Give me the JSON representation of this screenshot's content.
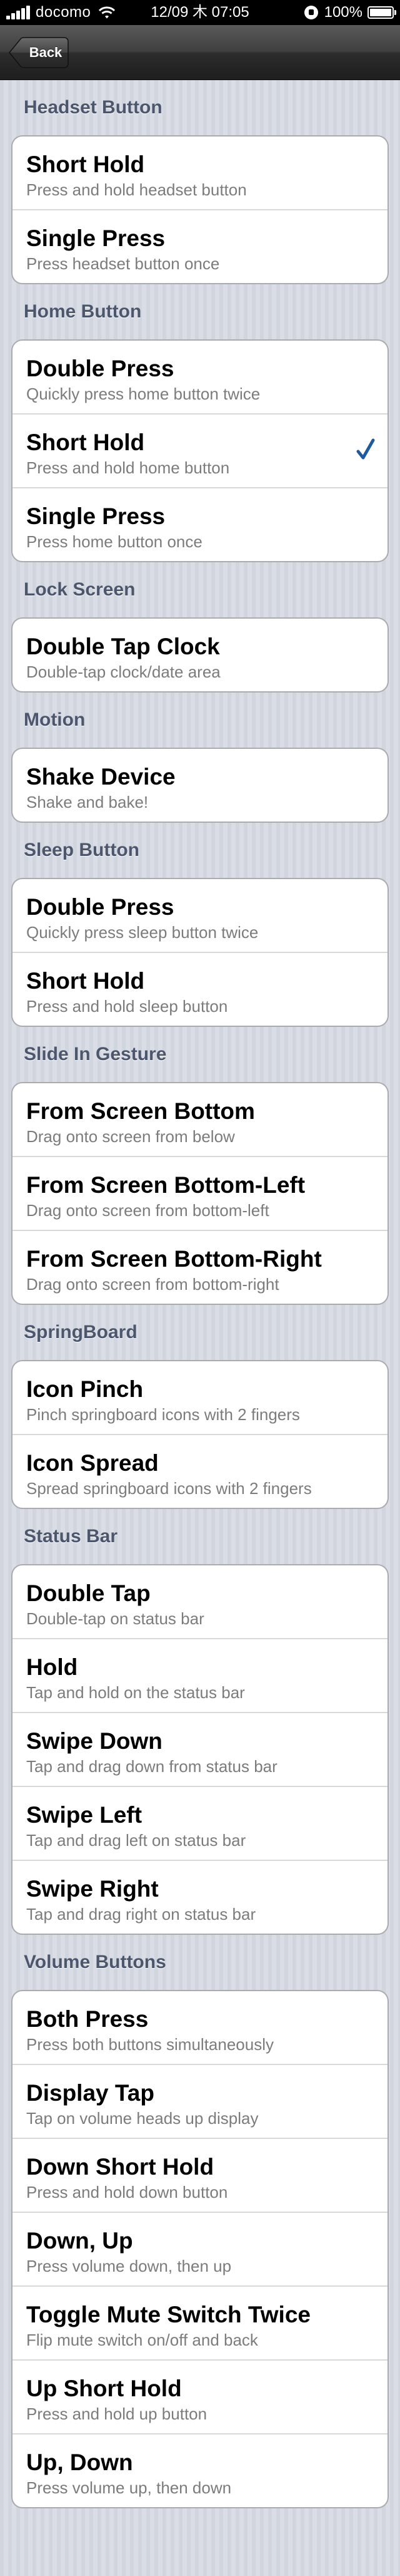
{
  "status_bar": {
    "carrier": "docomo",
    "time": "12/09 木 07:05",
    "battery_percent": "100%"
  },
  "nav": {
    "back_label": "Back"
  },
  "accent_color": "#1e5aa0",
  "sections": [
    {
      "header": "Headset Button",
      "items": [
        {
          "title": "Short Hold",
          "subtitle": "Press and hold headset button"
        },
        {
          "title": "Single Press",
          "subtitle": "Press headset button once"
        }
      ]
    },
    {
      "header": "Home Button",
      "items": [
        {
          "title": "Double Press",
          "subtitle": "Quickly press home button twice"
        },
        {
          "title": "Short Hold",
          "subtitle": "Press and hold home button",
          "checked": true
        },
        {
          "title": "Single Press",
          "subtitle": "Press home button once"
        }
      ]
    },
    {
      "header": "Lock Screen",
      "items": [
        {
          "title": "Double Tap Clock",
          "subtitle": "Double-tap clock/date area"
        }
      ]
    },
    {
      "header": "Motion",
      "items": [
        {
          "title": "Shake Device",
          "subtitle": "Shake and bake!"
        }
      ]
    },
    {
      "header": "Sleep Button",
      "items": [
        {
          "title": "Double Press",
          "subtitle": "Quickly press sleep button twice"
        },
        {
          "title": "Short Hold",
          "subtitle": "Press and hold sleep button"
        }
      ]
    },
    {
      "header": "Slide In Gesture",
      "items": [
        {
          "title": "From Screen Bottom",
          "subtitle": "Drag onto screen from below"
        },
        {
          "title": "From Screen Bottom-Left",
          "subtitle": "Drag onto screen from bottom-left"
        },
        {
          "title": "From Screen Bottom-Right",
          "subtitle": "Drag onto screen from bottom-right"
        }
      ]
    },
    {
      "header": "SpringBoard",
      "items": [
        {
          "title": "Icon Pinch",
          "subtitle": "Pinch springboard icons with 2 fingers"
        },
        {
          "title": "Icon Spread",
          "subtitle": "Spread springboard icons with 2 fingers"
        }
      ]
    },
    {
      "header": "Status Bar",
      "items": [
        {
          "title": "Double Tap",
          "subtitle": "Double-tap on status bar"
        },
        {
          "title": "Hold",
          "subtitle": "Tap and hold on the status bar"
        },
        {
          "title": "Swipe Down",
          "subtitle": "Tap and drag down from status bar"
        },
        {
          "title": "Swipe Left",
          "subtitle": "Tap and drag left on status bar"
        },
        {
          "title": "Swipe Right",
          "subtitle": "Tap and drag right on status bar"
        }
      ]
    },
    {
      "header": "Volume Buttons",
      "items": [
        {
          "title": "Both Press",
          "subtitle": "Press both buttons simultaneously"
        },
        {
          "title": "Display Tap",
          "subtitle": "Tap on volume heads up display"
        },
        {
          "title": "Down Short Hold",
          "subtitle": "Press and hold down button"
        },
        {
          "title": "Down, Up",
          "subtitle": "Press volume down, then up"
        },
        {
          "title": "Toggle Mute Switch Twice",
          "subtitle": "Flip mute switch on/off and back"
        },
        {
          "title": "Up Short Hold",
          "subtitle": "Press and hold up button"
        },
        {
          "title": "Up, Down",
          "subtitle": "Press volume up, then down"
        }
      ]
    }
  ]
}
